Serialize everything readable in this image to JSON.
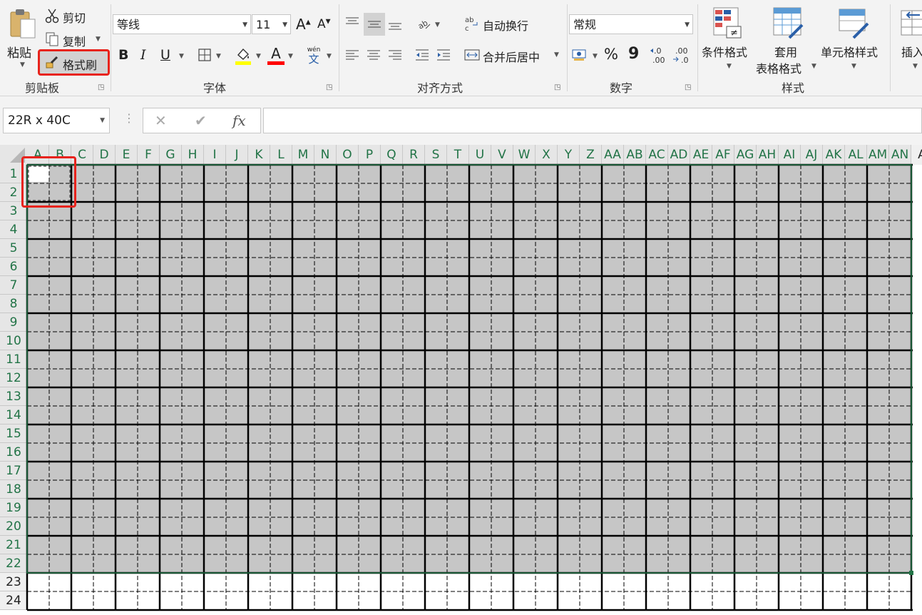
{
  "clipboard": {
    "paste_label": "粘贴",
    "cut_label": "剪切",
    "copy_label": "复制",
    "format_painter_label": "格式刷",
    "group_label": "剪贴板"
  },
  "font": {
    "font_name": "等线",
    "font_size": "11",
    "group_label": "字体",
    "bold_label": "B",
    "italic_label": "I",
    "underline_label": "U",
    "font_color_letter": "A",
    "phonetic_top": "wén",
    "phonetic_bottom": "文",
    "fill_color": "#ffff00",
    "font_color": "#ff0000"
  },
  "alignment": {
    "wrap_text_label": "自动换行",
    "merge_center_label": "合并后居中",
    "group_label": "对齐方式"
  },
  "number": {
    "format_value": "常规",
    "percent_label": "%",
    "comma_label": "9",
    "group_label": "数字"
  },
  "styles": {
    "conditional_format_label": "条件格式",
    "format_table_label_1": "套用",
    "format_table_label_2": "表格格式",
    "cell_styles_label": "单元格样式",
    "group_label": "样式"
  },
  "cells": {
    "insert_label": "插入"
  },
  "formula_bar": {
    "name_box": "22R x 40C",
    "cancel_symbol": "✕",
    "enter_symbol": "✔",
    "fx_label": "fx",
    "formula_value": ""
  },
  "sheet": {
    "columns": [
      "A",
      "B",
      "C",
      "D",
      "E",
      "F",
      "G",
      "H",
      "I",
      "J",
      "K",
      "L",
      "M",
      "N",
      "O",
      "P",
      "Q",
      "R",
      "S",
      "T",
      "U",
      "V",
      "W",
      "X",
      "Y",
      "Z",
      "AA",
      "AB",
      "AC",
      "AD",
      "AE",
      "AF",
      "AG",
      "AH",
      "AI",
      "AJ",
      "AK",
      "AL",
      "AM",
      "AN",
      "A"
    ],
    "rows": [
      "1",
      "2",
      "3",
      "4",
      "5",
      "6",
      "7",
      "8",
      "9",
      "10",
      "11",
      "12",
      "13",
      "14",
      "15",
      "16",
      "17",
      "18",
      "19",
      "20",
      "21",
      "22",
      "23",
      "24"
    ],
    "selected_rows": 22,
    "selected_cols": 40,
    "selection_fill": "#c6c6c6",
    "header_highlight_color": "#217346"
  }
}
